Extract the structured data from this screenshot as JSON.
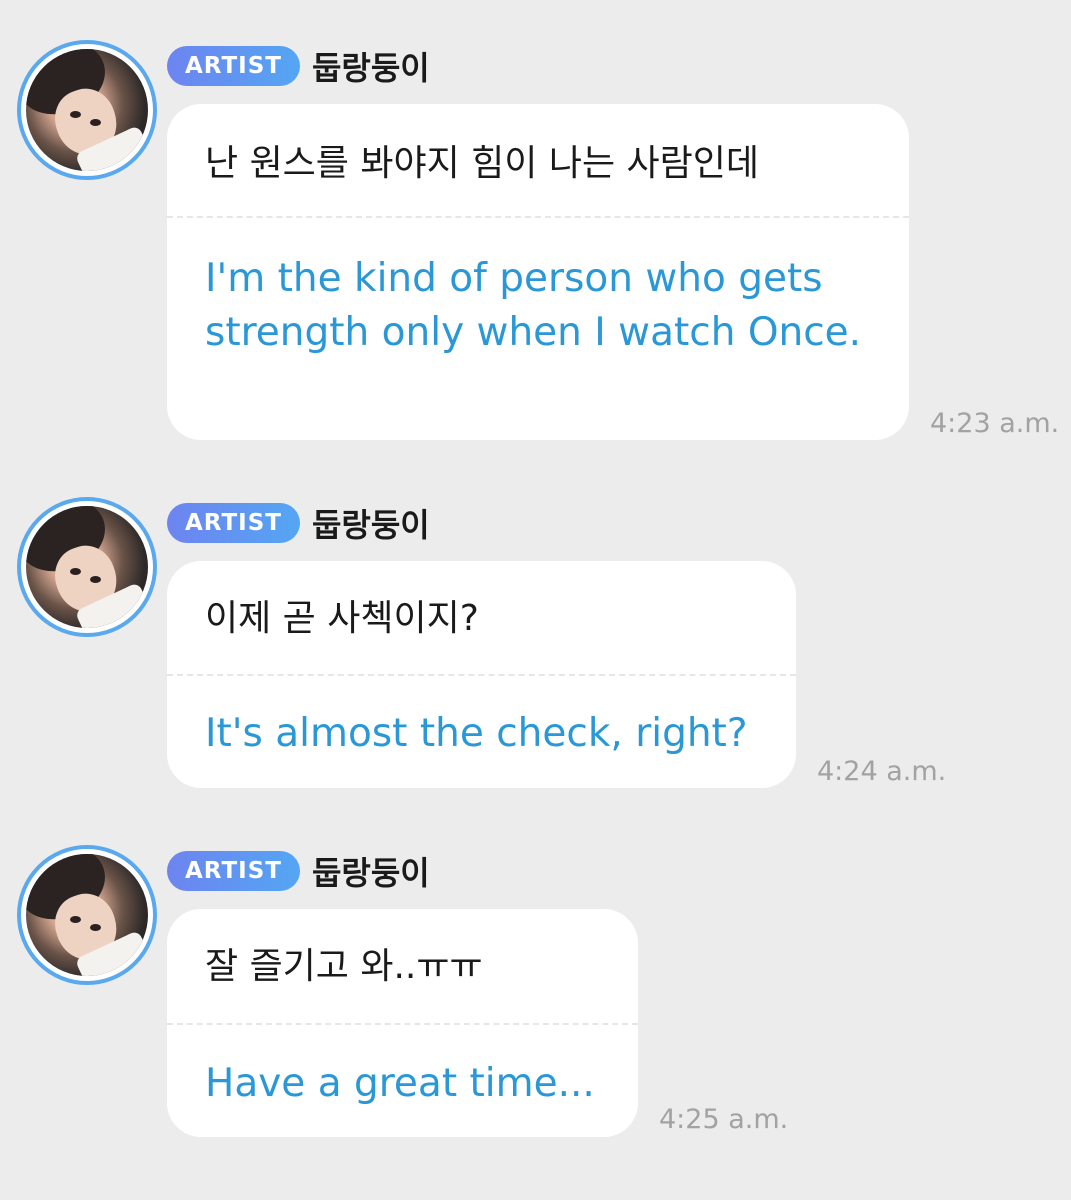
{
  "messages": [
    {
      "badge": "ARTIST",
      "sender": "둡랑둥이",
      "original": "난 원스를 봐야지 힘이 나는 사람인데",
      "translation": "I'm the kind of person who gets strength only when I watch Once.",
      "time": "4:23 a.m."
    },
    {
      "badge": "ARTIST",
      "sender": "둡랑둥이",
      "original": "이제 곧 사첵이지?",
      "translation": "It's almost the check, right?",
      "time": "4:24 a.m."
    },
    {
      "badge": "ARTIST",
      "sender": "둡랑둥이",
      "original": "잘 즐기고 와..ㅠㅠ",
      "translation": "Have a great time...",
      "time": "4:25 a.m."
    }
  ]
}
